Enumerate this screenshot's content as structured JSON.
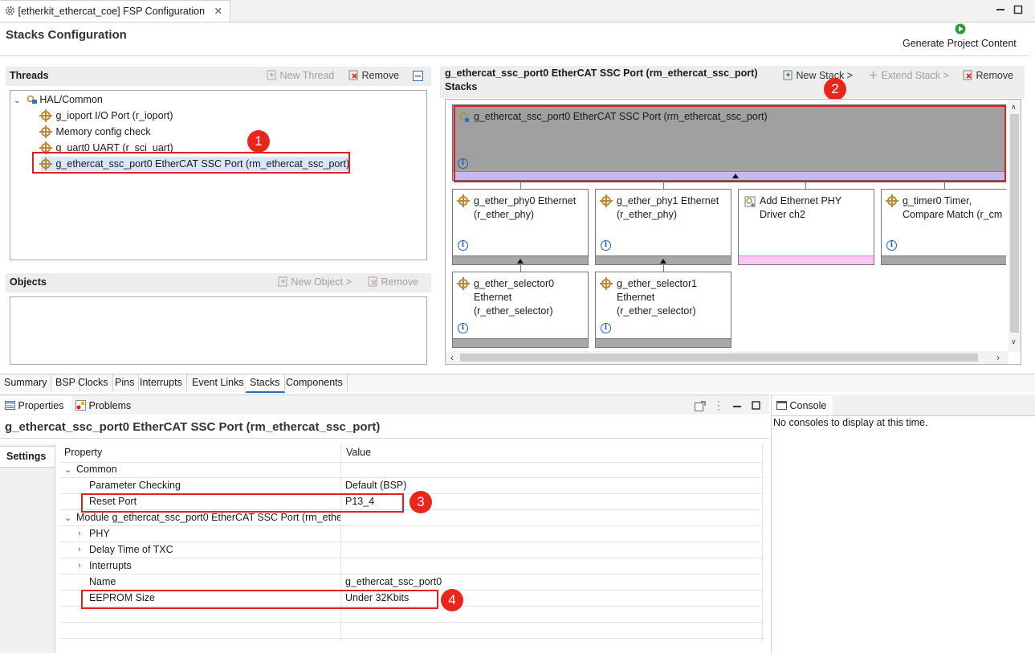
{
  "editor": {
    "tab_title": "[etherkit_ethercat_coe] FSP Configuration",
    "page_title": "Stacks Configuration",
    "generate_label": "Generate Project Content"
  },
  "threads": {
    "title": "Threads",
    "new_thread": "New Thread",
    "remove": "Remove",
    "items": [
      {
        "label": "HAL/Common"
      },
      {
        "label": "g_ioport I/O Port (r_ioport)"
      },
      {
        "label": "Memory config check"
      },
      {
        "label": "g_uart0 UART (r_sci_uart)"
      },
      {
        "label": "g_ethercat_ssc_port0 EtherCAT SSC Port (rm_ethercat_ssc_port)"
      }
    ]
  },
  "objects": {
    "title": "Objects",
    "new_object": "New Object >",
    "remove": "Remove"
  },
  "stacks": {
    "title_line1": "g_ethercat_ssc_port0 EtherCAT SSC Port (rm_ethercat_ssc_port)",
    "title_line2": "Stacks",
    "new_stack": "New Stack >",
    "extend_stack": "Extend Stack >",
    "remove": "Remove",
    "top_module": "g_ethercat_ssc_port0 EtherCAT SSC Port (rm_ethercat_ssc_port)",
    "modules": [
      {
        "label": "g_ether_phy0 Ethernet\n(r_ether_phy)"
      },
      {
        "label": "g_ether_phy1 Ethernet\n(r_ether_phy)"
      },
      {
        "label": "Add Ethernet PHY\nDriver ch2"
      },
      {
        "label": "g_timer0 Timer,\nCompare Match (r_cm"
      },
      {
        "label": "g_ether_selector0\nEthernet\n(r_ether_selector)"
      },
      {
        "label": "g_ether_selector1\nEthernet\n(r_ether_selector)"
      }
    ]
  },
  "config_tabs": [
    "Summary",
    "BSP",
    "Clocks",
    "Pins",
    "Interrupts",
    "Event Links",
    "Stacks",
    "Components"
  ],
  "properties": {
    "tab_properties": "Properties",
    "tab_problems": "Problems",
    "title": "g_ethercat_ssc_port0 EtherCAT SSC Port (rm_ethercat_ssc_port)",
    "settings_tab": "Settings",
    "col_property": "Property",
    "col_value": "Value",
    "rows": [
      {
        "name": "Common",
        "value": ""
      },
      {
        "name": "Parameter Checking",
        "value": "Default (BSP)"
      },
      {
        "name": "Reset Port",
        "value": "P13_4"
      },
      {
        "name": "Module g_ethercat_ssc_port0 EtherCAT SSC Port (rm_ethe",
        "value": ""
      },
      {
        "name": "PHY",
        "value": ""
      },
      {
        "name": "Delay Time of TXC",
        "value": ""
      },
      {
        "name": "Interrupts",
        "value": ""
      },
      {
        "name": "Name",
        "value": "g_ethercat_ssc_port0"
      },
      {
        "name": "EEPROM Size",
        "value": "Under 32Kbits"
      }
    ]
  },
  "console": {
    "tab": "Console",
    "message": "No consoles to display at this time."
  },
  "annotations": [
    "1",
    "2",
    "3",
    "4"
  ],
  "colors": {
    "highlight_red": "#e02020",
    "badge_red": "#e8261b",
    "selected_module_bg": "#a0a0a0",
    "selected_strip": "#c9b8f0",
    "add_strip": "#f7c6f2"
  }
}
